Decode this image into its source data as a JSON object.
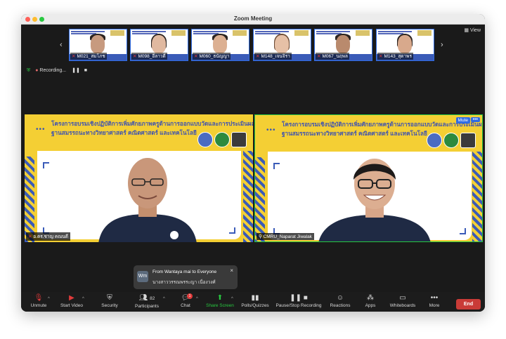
{
  "window": {
    "title": "Zoom Meeting"
  },
  "top": {
    "view_label": "View",
    "recording_label": "Recording..."
  },
  "thumbnails": [
    {
      "name": "M021_สมโภช"
    },
    {
      "name": "M098_อีลาวดี"
    },
    {
      "name": "M060_ธนัญญา"
    },
    {
      "name": "M148_เจนจิรา"
    },
    {
      "name": "M067_นฤพล"
    },
    {
      "name": "M143_สุดาพร"
    }
  ],
  "slide": {
    "line1": "โครงการอบรมเชิงปฏิบัติการเพิ่มศักยภาพครูด้านการออกแบบวัดและการประเมินผล",
    "line2": "ฐานสมรรถนะทางวิทยาศาสตร์ คณิตศาสตร์ และเทคโนโลยี",
    "dots": "•••"
  },
  "tiles": [
    {
      "name": "อ.ดร.ชาญ คณนดี"
    },
    {
      "name": "CMRU_Naparat Jiwalak",
      "mute_label": "Mute",
      "more_label": "•••"
    }
  ],
  "toast": {
    "avatar": "Wm",
    "from": "From Wantaya mai to Everyone",
    "message": "นางสาววรรณพรระญา เนื่องวงศ์",
    "close": "×"
  },
  "toolbar": {
    "unmute": "Unmute",
    "start_video": "Start Video",
    "security": "Security",
    "participants": "Participants",
    "participants_count": "82",
    "chat": "Chat",
    "chat_badge": "1",
    "share_screen": "Share Screen",
    "polls": "Polls/Quizzes",
    "pause_record": "Pause/Stop Recording",
    "reactions": "Reactions",
    "apps": "Apps",
    "whiteboards": "Whiteboards",
    "more": "More",
    "end": "End"
  },
  "colors": {
    "accent_blue": "#2f6ce5",
    "share_green": "#28c840",
    "end_red": "#c93b37",
    "slide_yellow": "#f4cf34",
    "slide_blue": "#3a5bb8"
  }
}
